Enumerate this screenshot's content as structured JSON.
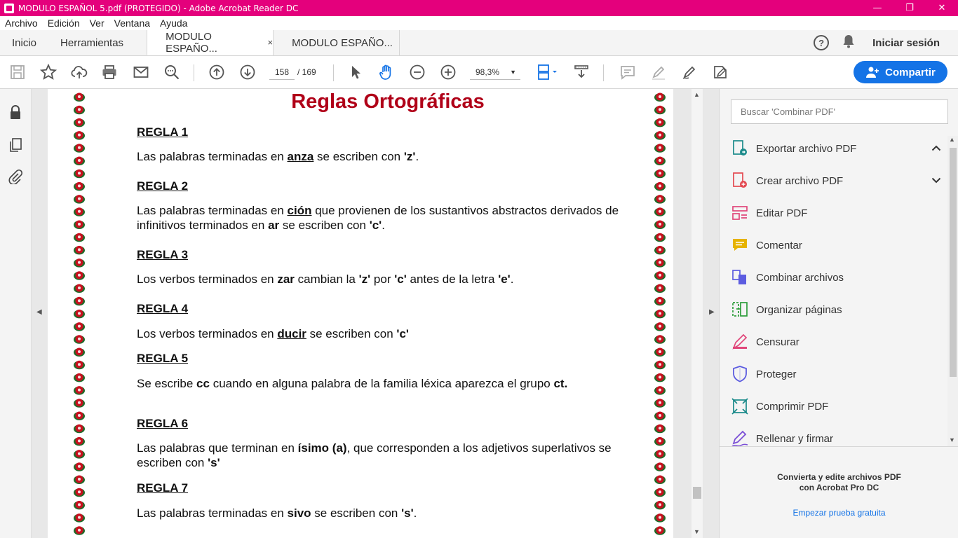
{
  "window": {
    "title": "MODULO ESPAÑOL 5.pdf (PROTEGIDO) - Adobe Acrobat Reader DC",
    "minimize": "—",
    "restore": "❐",
    "close": "✕"
  },
  "menu": [
    "Archivo",
    "Edición",
    "Ver",
    "Ventana",
    "Ayuda"
  ],
  "tabs": {
    "home": "Inicio",
    "tools": "Herramientas",
    "doc_active": "MODULO ESPAÑO...",
    "doc_other": "MODULO ESPAÑO...",
    "close": "×"
  },
  "header": {
    "help": "?",
    "signin": "Iniciar sesión"
  },
  "toolbar": {
    "page_current": "158",
    "page_total": "/ 169",
    "zoom": "98,3%",
    "share": "Compartir"
  },
  "document": {
    "title": "Reglas  Ortográficas",
    "rules": [
      {
        "heading": "REGLA 1",
        "parts": [
          [
            "Las palabras terminadas en ",
            ""
          ],
          [
            "anza",
            "bu"
          ],
          [
            " se escriben con ",
            ""
          ],
          [
            "'z'",
            "b"
          ],
          [
            ".",
            ""
          ]
        ]
      },
      {
        "heading": "REGLA 2",
        "parts": [
          [
            "Las palabras terminadas en ",
            ""
          ],
          [
            "ción",
            "bu"
          ],
          [
            " que provienen de los sustantivos abstractos derivados de infinitivos terminados en ",
            ""
          ],
          [
            "ar",
            "b"
          ],
          [
            " se escriben con ",
            ""
          ],
          [
            "'c'",
            "b"
          ],
          [
            ".",
            ""
          ]
        ]
      },
      {
        "heading": "REGLA 3",
        "parts": [
          [
            "Los verbos terminados en ",
            ""
          ],
          [
            "zar",
            "b"
          ],
          [
            " cambian la ",
            ""
          ],
          [
            "'z'",
            "b"
          ],
          [
            " por ",
            ""
          ],
          [
            "'c'",
            "b"
          ],
          [
            " antes de la letra ",
            ""
          ],
          [
            "'e'",
            "b"
          ],
          [
            ".",
            ""
          ]
        ]
      },
      {
        "heading": "REGLA 4",
        "parts": [
          [
            "Los verbos terminados en ",
            ""
          ],
          [
            "ducir",
            "bu"
          ],
          [
            " se escriben con ",
            ""
          ],
          [
            "'c'",
            "b"
          ]
        ]
      },
      {
        "heading": "REGLA 5",
        "parts": [
          [
            "Se escribe ",
            ""
          ],
          [
            "cc",
            "b"
          ],
          [
            " cuando en alguna palabra de la familia léxica aparezca el grupo ",
            ""
          ],
          [
            "ct.",
            "b"
          ]
        ]
      },
      {
        "heading": "REGLA 6",
        "parts": [
          [
            "Las palabras que terminan en ",
            ""
          ],
          [
            "ísimo (a)",
            "b"
          ],
          [
            ", que corresponden a los adjetivos superlativos se escriben con ",
            ""
          ],
          [
            "'s'",
            "b"
          ]
        ]
      },
      {
        "heading": "REGLA 7",
        "parts": [
          [
            "Las palabras terminadas en ",
            ""
          ],
          [
            "sivo",
            "b"
          ],
          [
            " se escriben con ",
            ""
          ],
          [
            "'s'",
            "b"
          ],
          [
            ".",
            ""
          ]
        ]
      }
    ]
  },
  "right_panel": {
    "search_placeholder": "Buscar 'Combinar PDF'",
    "tools": [
      {
        "label": "Exportar archivo PDF",
        "icon": "export-pdf-icon",
        "color": "#1a8a8a",
        "chevron": "up"
      },
      {
        "label": "Crear archivo PDF",
        "icon": "create-pdf-icon",
        "color": "#e34850",
        "chevron": "down"
      },
      {
        "label": "Editar PDF",
        "icon": "edit-pdf-icon",
        "color": "#e0467a"
      },
      {
        "label": "Comentar",
        "icon": "comment-icon",
        "color": "#e6b300"
      },
      {
        "label": "Combinar archivos",
        "icon": "combine-files-icon",
        "color": "#5c5ce0"
      },
      {
        "label": "Organizar páginas",
        "icon": "organize-pages-icon",
        "color": "#2d9d3a"
      },
      {
        "label": "Censurar",
        "icon": "redact-icon",
        "color": "#e0467a"
      },
      {
        "label": "Proteger",
        "icon": "protect-icon",
        "color": "#5c5ce0"
      },
      {
        "label": "Comprimir PDF",
        "icon": "compress-pdf-icon",
        "color": "#1a8a8a"
      },
      {
        "label": "Rellenar y firmar",
        "icon": "fill-sign-icon",
        "color": "#7a4ed6"
      }
    ],
    "promo_line1": "Convierta y edite archivos PDF",
    "promo_line2": "con Acrobat Pro DC",
    "promo_link": "Empezar prueba gratuita"
  },
  "colors": {
    "titlebar": "#e4007c",
    "accent": "#1473e6",
    "doc_title": "#b00018"
  }
}
